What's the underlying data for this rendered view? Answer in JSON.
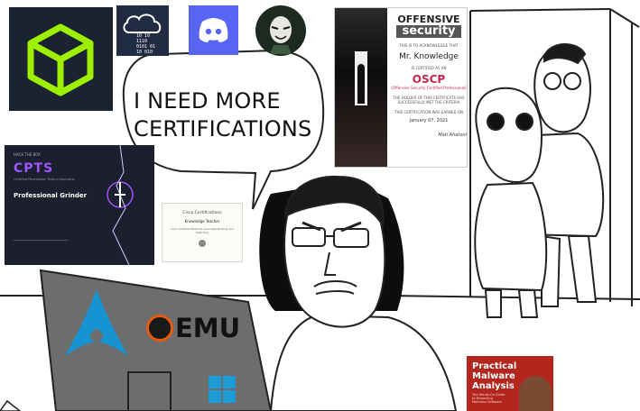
{
  "speech": {
    "line1": "I NEED MORE",
    "line2": "CERTIFICATIONS"
  },
  "logos": {
    "hackthebox": {
      "icon": "cube-icon",
      "bg": "#1a2332",
      "accent": "#9fef00"
    },
    "tryhackme": {
      "icon": "cloud-binary-icon",
      "bg": "#212c42",
      "lines": [
        "10 10",
        "1110",
        "0101 01",
        "10 010"
      ]
    },
    "discord": {
      "icon": "discord-icon",
      "bg": "#5865f2"
    },
    "mrrobot": {
      "icon": "mask-icon",
      "bg": "#1d2a22"
    }
  },
  "offsec_cert": {
    "brand_top": "OFFENSIVE",
    "brand_bottom": "security",
    "subtitle": "THIS IS TO ACKNOWLEDGE THAT",
    "name": "Mr. Knowledge",
    "has_earned": "IS CERTIFIED AS AN",
    "cert": "OSCP",
    "cert_full": "(Offensive Security Certified Professional)",
    "body": "THE HOLDER OF THIS CERTIFICATE HAS SUCCESSFULLY MET THE CRITERIA",
    "issued": "THIS CERTIFICATION WAS EARNED ON",
    "date": "January 07, 2021",
    "signer": "Mati Aharoni"
  },
  "cpts_cert": {
    "brand": "HACK THE BOX",
    "title": "CPTS",
    "subtitle": "Certified Penetration Testing Specialist",
    "holder": "Professional Grinder",
    "bg": "#1b1f2e",
    "accent": "#9f55ff"
  },
  "cisco_cert": {
    "header": "Cisco Certifications",
    "name": "Knowledge Teacher",
    "body": "Cisco Certified Network Associate Routing and Switching"
  },
  "laptop": {
    "arch_icon": "arch-linux-icon",
    "qemu_text": "EMU",
    "windows_icon": "windows-icon",
    "body": "#6d6d6d"
  },
  "book": {
    "title_lines": [
      "Practical",
      "Malware",
      "Analysis"
    ],
    "subtitle": "The Hands-On Guide to Dissecting Malicious Software",
    "bg": "#b3261e"
  }
}
